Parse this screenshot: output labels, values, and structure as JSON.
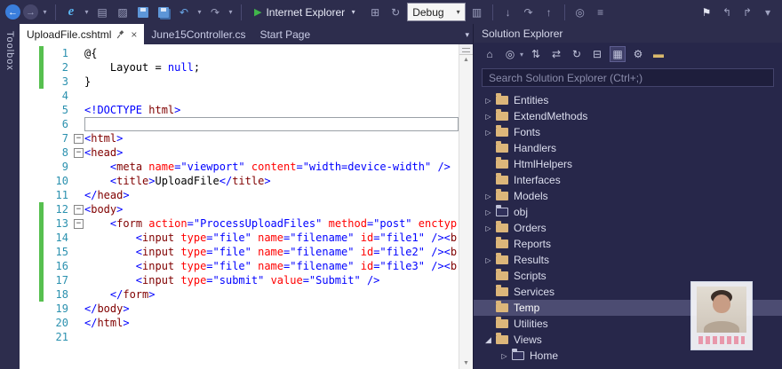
{
  "icons": {
    "chevron": "▾",
    "close": "×",
    "collapsed_arrow": "▷",
    "expanded_arrow": "◢",
    "fold_minus": "−",
    "scroll_up": "▲",
    "scroll_down": "▼"
  },
  "toolbar": {
    "items": [
      {
        "t": "icon",
        "name": "navigate-backward",
        "glyph": "←",
        "style": "circle-blue"
      },
      {
        "t": "icon",
        "name": "navigate-forward",
        "glyph": "→",
        "style": "circle-dim"
      },
      {
        "t": "chev"
      },
      {
        "t": "sep"
      },
      {
        "t": "icon",
        "name": "browse-with",
        "glyph": "e",
        "style": "ie"
      },
      {
        "t": "chev"
      },
      {
        "t": "icon",
        "name": "new-file",
        "glyph": "▤",
        "style": "dim"
      },
      {
        "t": "icon",
        "name": "open-file",
        "glyph": "▨",
        "style": "dim"
      },
      {
        "t": "icon",
        "name": "save",
        "style": "floppy"
      },
      {
        "t": "icon",
        "name": "save-all",
        "style": "floppy2"
      },
      {
        "t": "icon",
        "name": "undo",
        "glyph": "↶",
        "style": "blue"
      },
      {
        "t": "chev"
      },
      {
        "t": "icon",
        "name": "redo",
        "glyph": "↷",
        "style": "dim"
      },
      {
        "t": "chev"
      },
      {
        "t": "sep"
      },
      {
        "t": "run",
        "name": "start-debugging",
        "glyph": "▶",
        "label": "Internet Explorer"
      },
      {
        "t": "icon",
        "name": "attach-to-process",
        "glyph": "⊞",
        "style": "dim"
      },
      {
        "t": "icon",
        "name": "browser-link-refresh",
        "glyph": "↻",
        "style": "dim"
      },
      {
        "t": "combo",
        "name": "solution-configurations",
        "label": "Debug"
      },
      {
        "t": "icon",
        "name": "solution-platforms",
        "glyph": "▥",
        "style": "dim"
      },
      {
        "t": "sep"
      },
      {
        "t": "icon",
        "name": "step-into",
        "glyph": "↓",
        "style": "dim"
      },
      {
        "t": "icon",
        "name": "step-over",
        "glyph": "↷",
        "style": "dim"
      },
      {
        "t": "icon",
        "name": "step-out",
        "glyph": "↑",
        "style": "dim"
      },
      {
        "t": "sep"
      },
      {
        "t": "icon",
        "name": "find-in-files",
        "glyph": "◎",
        "style": "dim"
      },
      {
        "t": "icon",
        "name": "navigate-to",
        "glyph": "≡",
        "style": "dim"
      },
      {
        "t": "spacer"
      },
      {
        "t": "icon",
        "name": "toggle-bookmark",
        "glyph": "⚑",
        "style": "light"
      },
      {
        "t": "icon",
        "name": "previous-bookmark",
        "glyph": "↰",
        "style": "dim"
      },
      {
        "t": "icon",
        "name": "next-bookmark",
        "glyph": "↱",
        "style": "dim"
      },
      {
        "t": "icon",
        "name": "toolbar-options",
        "glyph": "▾",
        "style": "dim"
      }
    ]
  },
  "toolbox": {
    "label": "Toolbox"
  },
  "tabs": [
    {
      "label": "UploadFile.cshtml",
      "active": true
    },
    {
      "label": "June15Controller.cs",
      "active": false
    },
    {
      "label": "Start Page",
      "active": false
    }
  ],
  "editor": {
    "lines": [
      {
        "n": 1,
        "chg": true,
        "segs": [
          [
            "p",
            "@{"
          ]
        ]
      },
      {
        "n": 2,
        "chg": true,
        "segs": [
          [
            "p",
            "    Layout = "
          ],
          [
            "k",
            "null"
          ],
          [
            "p",
            ";"
          ]
        ]
      },
      {
        "n": 3,
        "chg": true,
        "segs": [
          [
            "p",
            "}"
          ]
        ]
      },
      {
        "n": 4,
        "segs": []
      },
      {
        "n": 5,
        "segs": [
          [
            "d",
            "<!DOCTYPE "
          ],
          [
            "t",
            "html"
          ],
          [
            "d",
            ">"
          ]
        ]
      },
      {
        "n": 6,
        "caret": true,
        "segs": []
      },
      {
        "n": 7,
        "fold": true,
        "segs": [
          [
            "d",
            "<"
          ],
          [
            "t",
            "html"
          ],
          [
            "d",
            ">"
          ]
        ]
      },
      {
        "n": 8,
        "fold": true,
        "segs": [
          [
            "d",
            "<"
          ],
          [
            "t",
            "head"
          ],
          [
            "d",
            ">"
          ]
        ]
      },
      {
        "n": 9,
        "segs": [
          [
            "p",
            "    "
          ],
          [
            "d",
            "<"
          ],
          [
            "t",
            "meta"
          ],
          [
            "p",
            " "
          ],
          [
            "a",
            "name"
          ],
          [
            "v",
            "=\"viewport\""
          ],
          [
            "p",
            " "
          ],
          [
            "a",
            "content"
          ],
          [
            "v",
            "=\"width=device-width\""
          ],
          [
            "p",
            " "
          ],
          [
            "d",
            "/>"
          ]
        ]
      },
      {
        "n": 10,
        "segs": [
          [
            "p",
            "    "
          ],
          [
            "d",
            "<"
          ],
          [
            "t",
            "title"
          ],
          [
            "d",
            ">"
          ],
          [
            "p",
            "UploadFile"
          ],
          [
            "d",
            "</"
          ],
          [
            "t",
            "title"
          ],
          [
            "d",
            ">"
          ]
        ]
      },
      {
        "n": 11,
        "segs": [
          [
            "d",
            "</"
          ],
          [
            "t",
            "head"
          ],
          [
            "d",
            ">"
          ]
        ]
      },
      {
        "n": 12,
        "chg": true,
        "fold": true,
        "segs": [
          [
            "d",
            "<"
          ],
          [
            "t",
            "body"
          ],
          [
            "d",
            ">"
          ]
        ]
      },
      {
        "n": 13,
        "chg": true,
        "fold": true,
        "segs": [
          [
            "p",
            "    "
          ],
          [
            "d",
            "<"
          ],
          [
            "t",
            "form"
          ],
          [
            "p",
            " "
          ],
          [
            "a",
            "action"
          ],
          [
            "v",
            "=\"ProcessUploadFiles\""
          ],
          [
            "p",
            " "
          ],
          [
            "a",
            "method"
          ],
          [
            "v",
            "=\"post\""
          ],
          [
            "p",
            " "
          ],
          [
            "a",
            "enctyp"
          ]
        ]
      },
      {
        "n": 14,
        "chg": true,
        "segs": [
          [
            "p",
            "        "
          ],
          [
            "d",
            "<"
          ],
          [
            "t",
            "input"
          ],
          [
            "p",
            " "
          ],
          [
            "a",
            "type"
          ],
          [
            "v",
            "=\"file\""
          ],
          [
            "p",
            " "
          ],
          [
            "a",
            "name"
          ],
          [
            "v",
            "=\"filename\""
          ],
          [
            "p",
            " "
          ],
          [
            "a",
            "id"
          ],
          [
            "v",
            "=\"file1\""
          ],
          [
            "p",
            " "
          ],
          [
            "d",
            "/><"
          ],
          [
            "t",
            "b"
          ]
        ]
      },
      {
        "n": 15,
        "chg": true,
        "segs": [
          [
            "p",
            "        "
          ],
          [
            "d",
            "<"
          ],
          [
            "t",
            "input"
          ],
          [
            "p",
            " "
          ],
          [
            "a",
            "type"
          ],
          [
            "v",
            "=\"file\""
          ],
          [
            "p",
            " "
          ],
          [
            "a",
            "name"
          ],
          [
            "v",
            "=\"filename\""
          ],
          [
            "p",
            " "
          ],
          [
            "a",
            "id"
          ],
          [
            "v",
            "=\"file2\""
          ],
          [
            "p",
            " "
          ],
          [
            "d",
            "/><"
          ],
          [
            "t",
            "b"
          ]
        ]
      },
      {
        "n": 16,
        "chg": true,
        "segs": [
          [
            "p",
            "        "
          ],
          [
            "d",
            "<"
          ],
          [
            "t",
            "input"
          ],
          [
            "p",
            " "
          ],
          [
            "a",
            "type"
          ],
          [
            "v",
            "=\"file\""
          ],
          [
            "p",
            " "
          ],
          [
            "a",
            "name"
          ],
          [
            "v",
            "=\"filename\""
          ],
          [
            "p",
            " "
          ],
          [
            "a",
            "id"
          ],
          [
            "v",
            "=\"file3\""
          ],
          [
            "p",
            " "
          ],
          [
            "d",
            "/><"
          ],
          [
            "t",
            "b"
          ]
        ]
      },
      {
        "n": 17,
        "chg": true,
        "segs": [
          [
            "p",
            "        "
          ],
          [
            "d",
            "<"
          ],
          [
            "t",
            "input"
          ],
          [
            "p",
            " "
          ],
          [
            "a",
            "type"
          ],
          [
            "v",
            "=\"submit\""
          ],
          [
            "p",
            " "
          ],
          [
            "a",
            "value"
          ],
          [
            "v",
            "=\"Submit\""
          ],
          [
            "p",
            " "
          ],
          [
            "d",
            "/>"
          ]
        ]
      },
      {
        "n": 18,
        "chg": true,
        "segs": [
          [
            "p",
            "    "
          ],
          [
            "d",
            "</"
          ],
          [
            "t",
            "form"
          ],
          [
            "d",
            ">"
          ]
        ]
      },
      {
        "n": 19,
        "segs": [
          [
            "d",
            "</"
          ],
          [
            "t",
            "body"
          ],
          [
            "d",
            ">"
          ]
        ]
      },
      {
        "n": 20,
        "segs": [
          [
            "d",
            "</"
          ],
          [
            "t",
            "html"
          ],
          [
            "d",
            ">"
          ]
        ]
      },
      {
        "n": 21,
        "segs": []
      }
    ]
  },
  "solution_explorer": {
    "title": "Solution Explorer",
    "toolbar": [
      {
        "name": "home",
        "glyph": "⌂"
      },
      {
        "name": "switch-views",
        "glyph": "◎",
        "chev": true
      },
      {
        "name": "pending-changes-filter",
        "glyph": "⇅"
      },
      {
        "name": "sync-with-active-document",
        "glyph": "⇄"
      },
      {
        "name": "refresh",
        "glyph": "↻"
      },
      {
        "name": "collapse-all",
        "glyph": "⊟"
      },
      {
        "name": "show-all-files",
        "glyph": "▦",
        "pressed": true
      },
      {
        "name": "properties",
        "glyph": "⚙"
      },
      {
        "name": "preview-selected-items",
        "glyph": "▬",
        "gold": true
      }
    ],
    "search_placeholder": "Search Solution Explorer (Ctrl+;)",
    "tree": [
      {
        "label": "Entities",
        "arrow": "collapsed",
        "icon": "folder",
        "level": 1
      },
      {
        "label": "ExtendMethods",
        "arrow": "collapsed",
        "icon": "folder",
        "level": 1
      },
      {
        "label": "Fonts",
        "arrow": "collapsed",
        "icon": "folder",
        "level": 1
      },
      {
        "label": "Handlers",
        "arrow": "none",
        "icon": "folder",
        "level": 1
      },
      {
        "label": "HtmlHelpers",
        "arrow": "none",
        "icon": "folder",
        "level": 1
      },
      {
        "label": "Interfaces",
        "arrow": "none",
        "icon": "folder",
        "level": 1
      },
      {
        "label": "Models",
        "arrow": "collapsed",
        "icon": "folder",
        "level": 1
      },
      {
        "label": "obj",
        "arrow": "collapsed",
        "icon": "folder-outline",
        "level": 1
      },
      {
        "label": "Orders",
        "arrow": "collapsed",
        "icon": "folder",
        "level": 1
      },
      {
        "label": "Reports",
        "arrow": "none",
        "icon": "folder",
        "level": 1
      },
      {
        "label": "Results",
        "arrow": "collapsed",
        "icon": "folder",
        "level": 1
      },
      {
        "label": "Scripts",
        "arrow": "none",
        "icon": "folder",
        "level": 1
      },
      {
        "label": "Services",
        "arrow": "none",
        "icon": "folder",
        "level": 1
      },
      {
        "label": "Temp",
        "arrow": "none",
        "icon": "folder",
        "level": 1,
        "selected": true
      },
      {
        "label": "Utilities",
        "arrow": "none",
        "icon": "folder",
        "level": 1
      },
      {
        "label": "Views",
        "arrow": "expanded",
        "icon": "folder",
        "level": 1
      },
      {
        "label": "Home",
        "arrow": "collapsed",
        "icon": "folder-outline",
        "level": 2
      }
    ]
  }
}
